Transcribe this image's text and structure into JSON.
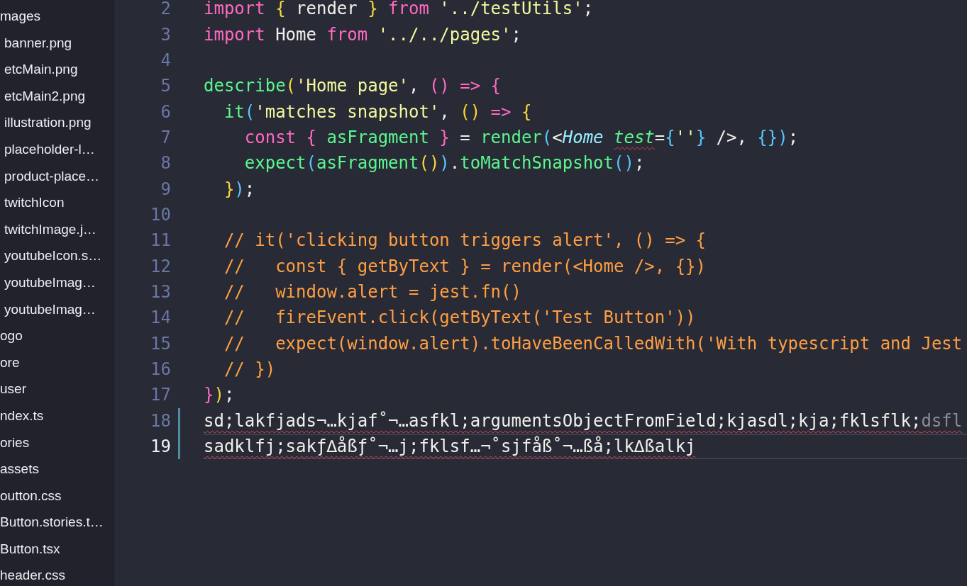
{
  "sidebar": {
    "items": [
      {
        "name": "mages",
        "children": [
          {
            "name": "banner.png"
          },
          {
            "name": "etcMain.png"
          },
          {
            "name": "etcMain2.png"
          },
          {
            "name": "illustration.png"
          },
          {
            "name": "placeholder-l…"
          },
          {
            "name": "product-place…"
          },
          {
            "name": "twitchIcon"
          },
          {
            "name": "twitchImage.j…"
          },
          {
            "name": "youtubeIcon.s…"
          },
          {
            "name": "youtubeImag…"
          },
          {
            "name": "youtubeImag…"
          }
        ]
      },
      {
        "name": "ogo"
      },
      {
        "name": "ore"
      },
      {
        "name": "user"
      },
      {
        "name": "ndex.ts"
      },
      {
        "name": "ories"
      },
      {
        "name": "assets"
      },
      {
        "name": "outton.css"
      },
      {
        "name": "Button.stories.t…"
      },
      {
        "name": "Button.tsx"
      },
      {
        "name": "header.css"
      }
    ]
  },
  "editor": {
    "lines": [
      {
        "number": "2",
        "modified": false,
        "current": false,
        "tokens": [
          {
            "text": "import ",
            "kind": "keyword"
          },
          {
            "text": "{",
            "kind": "b1"
          },
          {
            "text": " render ",
            "kind": "plain"
          },
          {
            "text": "}",
            "kind": "b1"
          },
          {
            "text": " from ",
            "kind": "keyword"
          },
          {
            "text": "'../testUtils'",
            "kind": "string"
          },
          {
            "text": ";",
            "kind": "plain"
          }
        ]
      },
      {
        "number": "3",
        "modified": false,
        "current": false,
        "tokens": [
          {
            "text": "import",
            "kind": "keyword"
          },
          {
            "text": " Home ",
            "kind": "plain"
          },
          {
            "text": "from ",
            "kind": "keyword"
          },
          {
            "text": "'../../pages'",
            "kind": "string"
          },
          {
            "text": ";",
            "kind": "plain"
          }
        ]
      },
      {
        "number": "4",
        "modified": false,
        "current": false
      },
      {
        "number": "5",
        "modified": false,
        "current": false,
        "tokens": [
          {
            "text": "describe",
            "kind": "func"
          },
          {
            "text": "(",
            "kind": "b1"
          },
          {
            "text": "'Home page'",
            "kind": "string"
          },
          {
            "text": ", ",
            "kind": "plain"
          },
          {
            "text": "()",
            "kind": "b2"
          },
          {
            "text": " => {",
            "kind": "keyword"
          }
        ]
      },
      {
        "number": "6",
        "modified": false,
        "current": false,
        "tokens": [
          {
            "text": "  it",
            "kind": "func"
          },
          {
            "text": "(",
            "kind": "b3"
          },
          {
            "text": "'matches snapshot'",
            "kind": "string"
          },
          {
            "text": ", ",
            "kind": "plain"
          },
          {
            "text": "()",
            "kind": "b1"
          },
          {
            "text": " => ",
            "kind": "keyword"
          },
          {
            "text": "{",
            "kind": "b1"
          }
        ]
      },
      {
        "number": "7",
        "modified": false,
        "current": false,
        "tokens": [
          {
            "text": "    const ",
            "kind": "keyword"
          },
          {
            "text": "{",
            "kind": "b2"
          },
          {
            "text": " asFragment ",
            "kind": "func"
          },
          {
            "text": "}",
            "kind": "b2"
          },
          {
            "text": " = ",
            "kind": "plain"
          },
          {
            "text": "render",
            "kind": "func"
          },
          {
            "text": "(",
            "kind": "b3"
          },
          {
            "text": "<",
            "kind": "plain"
          },
          {
            "text": "Home ",
            "kind": "component"
          },
          {
            "text": "test",
            "kind": "attr",
            "error": true
          },
          {
            "text": "=",
            "kind": "plain"
          },
          {
            "text": "{",
            "kind": "b3"
          },
          {
            "text": "''",
            "kind": "string"
          },
          {
            "text": "}",
            "kind": "b3"
          },
          {
            "text": " />, ",
            "kind": "plain"
          },
          {
            "text": "{})",
            "kind": "b3"
          },
          {
            "text": ";",
            "kind": "plain"
          }
        ]
      },
      {
        "number": "8",
        "modified": false,
        "current": false,
        "tokens": [
          {
            "text": "    expect",
            "kind": "func"
          },
          {
            "text": "(",
            "kind": "b3"
          },
          {
            "text": "asFragment",
            "kind": "func"
          },
          {
            "text": "()",
            "kind": "b1"
          },
          {
            "text": ")",
            "kind": "b3"
          },
          {
            "text": ".",
            "kind": "plain"
          },
          {
            "text": "toMatchSnapshot",
            "kind": "func"
          },
          {
            "text": "()",
            "kind": "b3"
          },
          {
            "text": ";",
            "kind": "plain"
          }
        ]
      },
      {
        "number": "9",
        "modified": false,
        "current": false,
        "tokens": [
          {
            "text": "  }",
            "kind": "b1"
          },
          {
            "text": ")",
            "kind": "b3"
          },
          {
            "text": ";",
            "kind": "plain"
          }
        ]
      },
      {
        "number": "10",
        "modified": false,
        "current": false
      },
      {
        "number": "11",
        "modified": false,
        "current": false,
        "tokens": [
          {
            "text": "  // it('clicking button triggers alert', () => {",
            "kind": "comment"
          }
        ]
      },
      {
        "number": "12",
        "modified": false,
        "current": false,
        "tokens": [
          {
            "text": "  //   const { getByText } = render(<Home />, {})",
            "kind": "comment"
          }
        ]
      },
      {
        "number": "13",
        "modified": false,
        "current": false,
        "tokens": [
          {
            "text": "  //   window.alert = jest.fn()",
            "kind": "comment"
          }
        ]
      },
      {
        "number": "14",
        "modified": false,
        "current": false,
        "tokens": [
          {
            "text": "  //   fireEvent.click(getByText('Test Button'))",
            "kind": "comment"
          }
        ]
      },
      {
        "number": "15",
        "modified": false,
        "current": false,
        "tokens": [
          {
            "text": "  //   expect(window.alert).toHaveBeenCalledWith('With typescript and Jest",
            "kind": "comment"
          }
        ]
      },
      {
        "number": "16",
        "modified": false,
        "current": false,
        "tokens": [
          {
            "text": "  // })",
            "kind": "comment"
          }
        ]
      },
      {
        "number": "17",
        "modified": false,
        "current": false,
        "tokens": [
          {
            "text": "}",
            "kind": "b2"
          },
          {
            "text": ")",
            "kind": "b1"
          },
          {
            "text": ";",
            "kind": "plain"
          }
        ]
      },
      {
        "number": "18",
        "modified": true,
        "current": false,
        "tokens": [
          {
            "text": "sd;lakfjads¬…kjaf˚¬…asfkl;argumentsObjectFromField;kjasdl;kja;fklsflk;",
            "kind": "plain",
            "error": true
          },
          {
            "text": "dsfl",
            "kind": "faded",
            "error": true
          }
        ]
      },
      {
        "number": "19",
        "modified": true,
        "current": true,
        "tokens": [
          {
            "text": "sadklfj;sakƒ∆åßƒ˚¬…j;fklsf…¬˚sjfåß˚¬…ßå;lk∆ßalkj",
            "kind": "plain",
            "error": true
          }
        ]
      }
    ]
  }
}
